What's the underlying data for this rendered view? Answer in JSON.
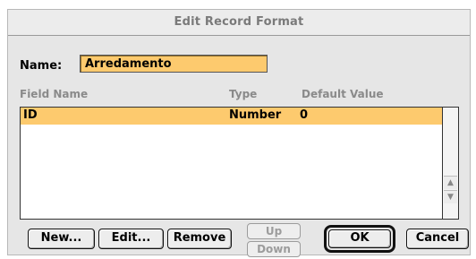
{
  "dialog": {
    "title": "Edit Record Format",
    "name_label": "Name:",
    "name_value": "Arredamento"
  },
  "columns": {
    "field_name": "Field Name",
    "type": "Type",
    "default_value": "Default Value"
  },
  "records": [
    {
      "field": "ID",
      "type": "Number",
      "default": "0"
    }
  ],
  "scrollbar": {
    "up_icon": "up-arrow-icon",
    "down_icon": "down-arrow-icon"
  },
  "buttons": {
    "new": "New...",
    "edit": "Edit...",
    "remove": "Remove",
    "up": "Up",
    "down": "Down",
    "ok": "OK",
    "cancel": "Cancel"
  },
  "colors": {
    "highlight": "#fdca6e",
    "background": "#e6e6e6"
  }
}
